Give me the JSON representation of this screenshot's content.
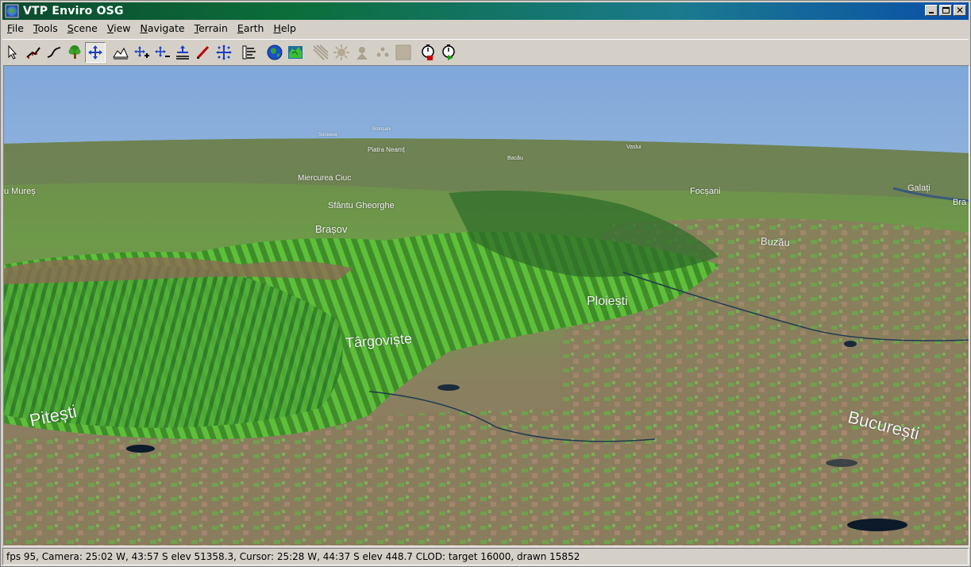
{
  "window": {
    "title": "VTP Enviro OSG",
    "colors": {
      "titlebar_start": "#0b6e3a",
      "titlebar_end": "#0a4fa8",
      "chrome": "#d4d0c8"
    }
  },
  "menu": {
    "items": [
      {
        "label": "File"
      },
      {
        "label": "Tools"
      },
      {
        "label": "Scene"
      },
      {
        "label": "View"
      },
      {
        "label": "Navigate"
      },
      {
        "label": "Terrain"
      },
      {
        "label": "Earth"
      },
      {
        "label": "Help"
      }
    ]
  },
  "toolbar": {
    "groups": [
      [
        "select-arrow-icon",
        "fence-icon",
        "route-icon",
        "tree-icon",
        "move-cross-icon"
      ],
      [
        "terrain-fly-icon",
        "zoom-in-nav-icon",
        "zoom-out-nav-icon",
        "ground-elevation-icon",
        "pencil-line-icon",
        "pan-arrows-icon"
      ],
      [
        "layers-icon"
      ],
      [
        "globe-icon",
        "terrain-map-icon"
      ],
      [
        "sun-rays-icon",
        "sun-icon",
        "camera-tripod-icon",
        "dots-icon",
        "blank-square-icon"
      ],
      [
        "stopwatch-red-icon",
        "stopwatch-green-icon"
      ]
    ],
    "active": "move-cross-icon",
    "disabled": [
      "sun-rays-icon",
      "sun-icon",
      "camera-tripod-icon",
      "dots-icon",
      "blank-square-icon"
    ]
  },
  "scene": {
    "places": [
      {
        "name": "Pitești"
      },
      {
        "name": "Târgoviște"
      },
      {
        "name": "Ploiești"
      },
      {
        "name": "București"
      },
      {
        "name": "Brașov"
      },
      {
        "name": "Buzău"
      },
      {
        "name": "Focșani"
      },
      {
        "name": "Sfântu Gheorghe"
      },
      {
        "name": "Miercurea Ciuc"
      },
      {
        "name": "Piatra Neamț"
      },
      {
        "name": "Galați"
      },
      {
        "name": "Bra"
      },
      {
        "name": "u Mureș"
      },
      {
        "name": "Vaslui"
      },
      {
        "name": "Bacău"
      },
      {
        "name": "Suceava"
      },
      {
        "name": "Botoșani"
      }
    ],
    "colors": {
      "sky_top": "#7fa7d8",
      "sky_horizon": "#c9dcf2",
      "forest": "#5fbf3a",
      "lowland": "#8a7d5e"
    }
  },
  "status": {
    "text": "fps  95, Camera:  25:02 W,  43:57 S elev 51358.3, Cursor:  25:28 W,  44:37 S elev 448.7 CLOD: target 16000, drawn 15852"
  }
}
